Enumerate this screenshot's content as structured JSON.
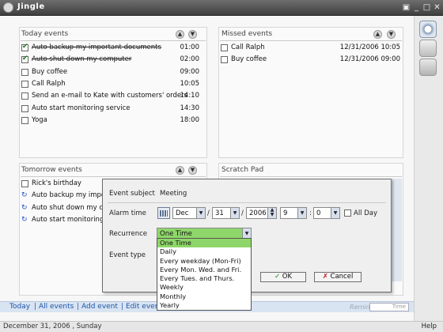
{
  "app": {
    "title": "Jingle"
  },
  "titlebar": {
    "icons": [
      "lock-icon",
      "minimize-icon",
      "maximize-icon",
      "close-icon"
    ],
    "glyphs": [
      "▣",
      "_",
      "□",
      "✕"
    ]
  },
  "today": {
    "title": "Today events",
    "rows": [
      {
        "text": "Auto backup my important documents",
        "time": "01:00",
        "checked": true,
        "done": true
      },
      {
        "text": "Auto shut down my computer",
        "time": "02:00",
        "checked": true,
        "done": true
      },
      {
        "text": "Buy coffee",
        "time": "09:00",
        "checked": false,
        "done": false
      },
      {
        "text": "Call Ralph",
        "time": "10:05",
        "checked": false,
        "done": false
      },
      {
        "text": "Send an e-mail to Kate with customers' orders",
        "time": "14:10",
        "checked": false,
        "done": false
      },
      {
        "text": "Auto start monitoring service",
        "time": "14:30",
        "checked": false,
        "done": false
      },
      {
        "text": "Yoga",
        "time": "18:00",
        "checked": false,
        "done": false
      }
    ]
  },
  "missed": {
    "title": "Missed events",
    "rows": [
      {
        "text": "Call Ralph",
        "time": "12/31/2006 10:05"
      },
      {
        "text": "Buy coffee",
        "time": "12/31/2006 09:00"
      }
    ]
  },
  "tomorrow": {
    "title": "Tomorrow events",
    "rows": [
      {
        "text": "Rick's birthday",
        "kind": "check"
      },
      {
        "text": "Auto backup my import",
        "kind": "recurring"
      },
      {
        "text": "Auto shut down my co",
        "kind": "recurring"
      },
      {
        "text": "Auto start monitoring s",
        "kind": "recurring"
      }
    ]
  },
  "scratch": {
    "title": "Scratch Pad"
  },
  "dialog": {
    "subject_label": "Event subject",
    "subject_value": "Meeting",
    "alarm_label": "Alarm time",
    "month": "Dec",
    "day": "31",
    "slash1": "/",
    "slash2": "/",
    "year": "2006",
    "hour": "9",
    "minute": "0",
    "colon": ":",
    "allday_label": "All Day",
    "recurrence_label": "Recurrence",
    "recurrence_value": "One Time",
    "type_label": "Event type",
    "ok_label": "OK",
    "cancel_label": "Cancel",
    "recurrence_options": [
      "One Time",
      "Daily",
      "Every weekday (Mon-Fri)",
      "Every Mon. Wed. and Fri.",
      "Every Tues. and Thurs.",
      "Weekly",
      "Monthly",
      "Yearly"
    ],
    "selected_index": 0
  },
  "nav": {
    "links": [
      "Today",
      "All events",
      "Add event",
      "Edit event"
    ],
    "tag": "Reminder",
    "time_box": "Time"
  },
  "status": {
    "date": "December 31, 2006 , Sunday",
    "help": "Help"
  },
  "colors": {
    "accent": "#1e55a8",
    "selection": "#8fd66a",
    "titlebar": "#4a4a4a"
  }
}
